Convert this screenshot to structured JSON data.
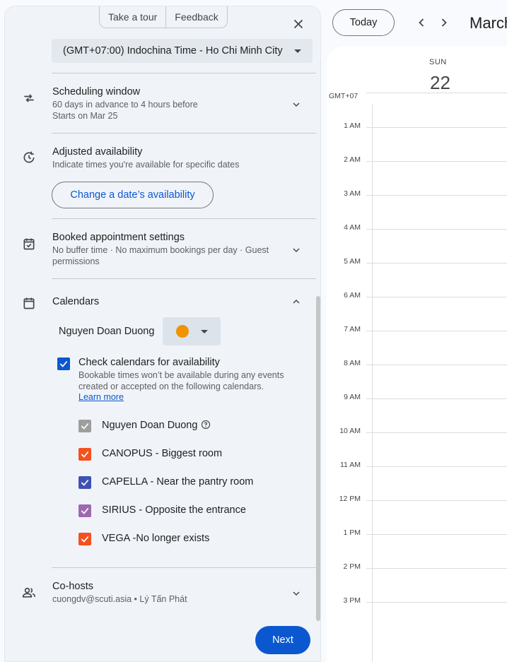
{
  "panel": {
    "tour_label": "Take a tour",
    "feedback_label": "Feedback",
    "timezone": "(GMT+07:00) Indochina Time - Ho Chi Minh City",
    "scheduling": {
      "title": "Scheduling window",
      "line1": "60 days in advance to 4 hours before",
      "line2": "Starts on Mar 25"
    },
    "adjusted": {
      "title": "Adjusted availability",
      "subtitle": "Indicate times you're available for specific dates",
      "button": "Change a date’s availability"
    },
    "booked": {
      "title": "Booked appointment settings",
      "line1": "No buffer time · No maximum bookings per day · Guest",
      "line2": "permissions"
    },
    "calendars": {
      "title": "Calendars",
      "owner": "Nguyen Doan Duong",
      "owner_color": "#f09300",
      "check_title": "Check calendars for availability",
      "check_sub": "Bookable times won’t be available during any events created or accepted on the following calendars.",
      "learn_more": "Learn more",
      "items": [
        {
          "label": "Nguyen Doan Duong",
          "color": "#9e9e9e"
        },
        {
          "label": "CANOPUS - Biggest room",
          "color": "#f4511e"
        },
        {
          "label": "CAPELLA - Near the pantry room",
          "color": "#3f51b5"
        },
        {
          "label": "SIRIUS - Opposite the entrance",
          "color": "#9e69af"
        },
        {
          "label": "VEGA -No longer exists",
          "color": "#f4511e"
        }
      ]
    },
    "cohosts": {
      "title": "Co-hosts",
      "subtitle": "cuongdv@scuti.asia • Lý Tấn Phát"
    },
    "next_label": "Next"
  },
  "calendar": {
    "today_label": "Today",
    "month_title": "March",
    "day_name": "SUN",
    "day_number": "22",
    "timezone_label": "GMT+07",
    "hours": [
      "1 AM",
      "2 AM",
      "3 AM",
      "4 AM",
      "5 AM",
      "6 AM",
      "7 AM",
      "8 AM",
      "9 AM",
      "10 AM",
      "11 AM",
      "12 PM",
      "1 PM",
      "2 PM",
      "3 PM"
    ]
  },
  "colors": {
    "primary": "#0b57d0",
    "main_checkbox": "#0b57d0"
  }
}
